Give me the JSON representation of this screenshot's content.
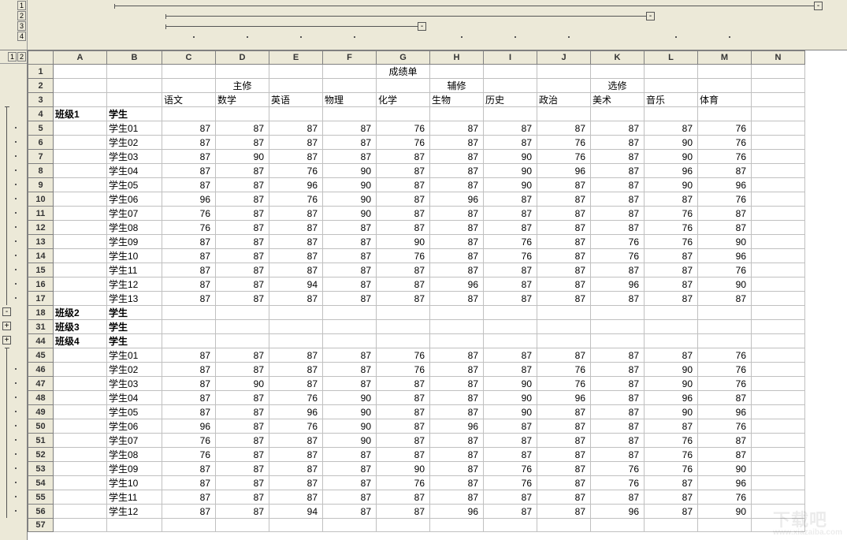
{
  "colLevels": [
    "1",
    "2",
    "3",
    "4"
  ],
  "rowLevels": [
    "1",
    "2"
  ],
  "columns": [
    "A",
    "B",
    "C",
    "D",
    "E",
    "F",
    "G",
    "H",
    "I",
    "J",
    "K",
    "L",
    "M",
    "N"
  ],
  "visibleRowNumbers": [
    1,
    2,
    3,
    4,
    5,
    6,
    7,
    8,
    9,
    10,
    11,
    12,
    13,
    14,
    15,
    16,
    17,
    18,
    31,
    44,
    45,
    46,
    47,
    48,
    49,
    50,
    51,
    52,
    53,
    54,
    55,
    56,
    57
  ],
  "title": "成绩单",
  "headers": {
    "groupA": "主修",
    "groupB": "辅修",
    "groupC": "选修",
    "subjects": [
      "语文",
      "数学",
      "英语",
      "物理",
      "化学",
      "生物",
      "历史",
      "政治",
      "美术",
      "音乐",
      "体育"
    ]
  },
  "classes": {
    "c1": {
      "label": "班级1",
      "student": "学生"
    },
    "c2": {
      "label": "班级2",
      "student": "学生"
    },
    "c3": {
      "label": "班级3",
      "student": "学生"
    },
    "c4": {
      "label": "班级4",
      "student": "学生"
    }
  },
  "group1": [
    {
      "name": "学生01",
      "s": [
        87,
        87,
        87,
        87,
        76,
        87,
        87,
        87,
        87,
        87,
        76
      ]
    },
    {
      "name": "学生02",
      "s": [
        87,
        87,
        87,
        87,
        76,
        87,
        87,
        76,
        87,
        90,
        76
      ]
    },
    {
      "name": "学生03",
      "s": [
        87,
        90,
        87,
        87,
        87,
        87,
        90,
        76,
        87,
        90,
        76
      ]
    },
    {
      "name": "学生04",
      "s": [
        87,
        87,
        76,
        90,
        87,
        87,
        90,
        96,
        87,
        96,
        87
      ]
    },
    {
      "name": "学生05",
      "s": [
        87,
        87,
        96,
        90,
        87,
        87,
        90,
        87,
        87,
        90,
        96
      ]
    },
    {
      "name": "学生06",
      "s": [
        96,
        87,
        76,
        90,
        87,
        96,
        87,
        87,
        87,
        87,
        76
      ]
    },
    {
      "name": "学生07",
      "s": [
        76,
        87,
        87,
        90,
        87,
        87,
        87,
        87,
        87,
        76,
        87
      ]
    },
    {
      "name": "学生08",
      "s": [
        76,
        87,
        87,
        87,
        87,
        87,
        87,
        87,
        87,
        76,
        87
      ]
    },
    {
      "name": "学生09",
      "s": [
        87,
        87,
        87,
        87,
        90,
        87,
        76,
        87,
        76,
        76,
        90
      ]
    },
    {
      "name": "学生10",
      "s": [
        87,
        87,
        87,
        87,
        76,
        87,
        76,
        87,
        76,
        87,
        96
      ]
    },
    {
      "name": "学生11",
      "s": [
        87,
        87,
        87,
        87,
        87,
        87,
        87,
        87,
        87,
        87,
        76
      ]
    },
    {
      "name": "学生12",
      "s": [
        87,
        87,
        94,
        87,
        87,
        96,
        87,
        87,
        96,
        87,
        90
      ]
    },
    {
      "name": "学生13",
      "s": [
        87,
        87,
        87,
        87,
        87,
        87,
        87,
        87,
        87,
        87,
        87
      ]
    }
  ],
  "group4": [
    {
      "name": "学生01",
      "s": [
        87,
        87,
        87,
        87,
        76,
        87,
        87,
        87,
        87,
        87,
        76
      ]
    },
    {
      "name": "学生02",
      "s": [
        87,
        87,
        87,
        87,
        76,
        87,
        87,
        76,
        87,
        90,
        76
      ]
    },
    {
      "name": "学生03",
      "s": [
        87,
        90,
        87,
        87,
        87,
        87,
        90,
        76,
        87,
        90,
        76
      ]
    },
    {
      "name": "学生04",
      "s": [
        87,
        87,
        76,
        90,
        87,
        87,
        90,
        96,
        87,
        96,
        87
      ]
    },
    {
      "name": "学生05",
      "s": [
        87,
        87,
        96,
        90,
        87,
        87,
        90,
        87,
        87,
        90,
        96
      ]
    },
    {
      "name": "学生06",
      "s": [
        96,
        87,
        76,
        90,
        87,
        96,
        87,
        87,
        87,
        87,
        76
      ]
    },
    {
      "name": "学生07",
      "s": [
        76,
        87,
        87,
        90,
        87,
        87,
        87,
        87,
        87,
        76,
        87
      ]
    },
    {
      "name": "学生08",
      "s": [
        76,
        87,
        87,
        87,
        87,
        87,
        87,
        87,
        87,
        76,
        87
      ]
    },
    {
      "name": "学生09",
      "s": [
        87,
        87,
        87,
        87,
        90,
        87,
        76,
        87,
        76,
        76,
        90
      ]
    },
    {
      "name": "学生10",
      "s": [
        87,
        87,
        87,
        87,
        76,
        87,
        76,
        87,
        76,
        87,
        96
      ]
    },
    {
      "name": "学生11",
      "s": [
        87,
        87,
        87,
        87,
        87,
        87,
        87,
        87,
        87,
        87,
        76
      ]
    },
    {
      "name": "学生12",
      "s": [
        87,
        87,
        94,
        87,
        87,
        96,
        87,
        87,
        96,
        87,
        90
      ]
    }
  ],
  "watermark": {
    "main": "下载吧",
    "sub": "www.xiazaiba.com"
  }
}
